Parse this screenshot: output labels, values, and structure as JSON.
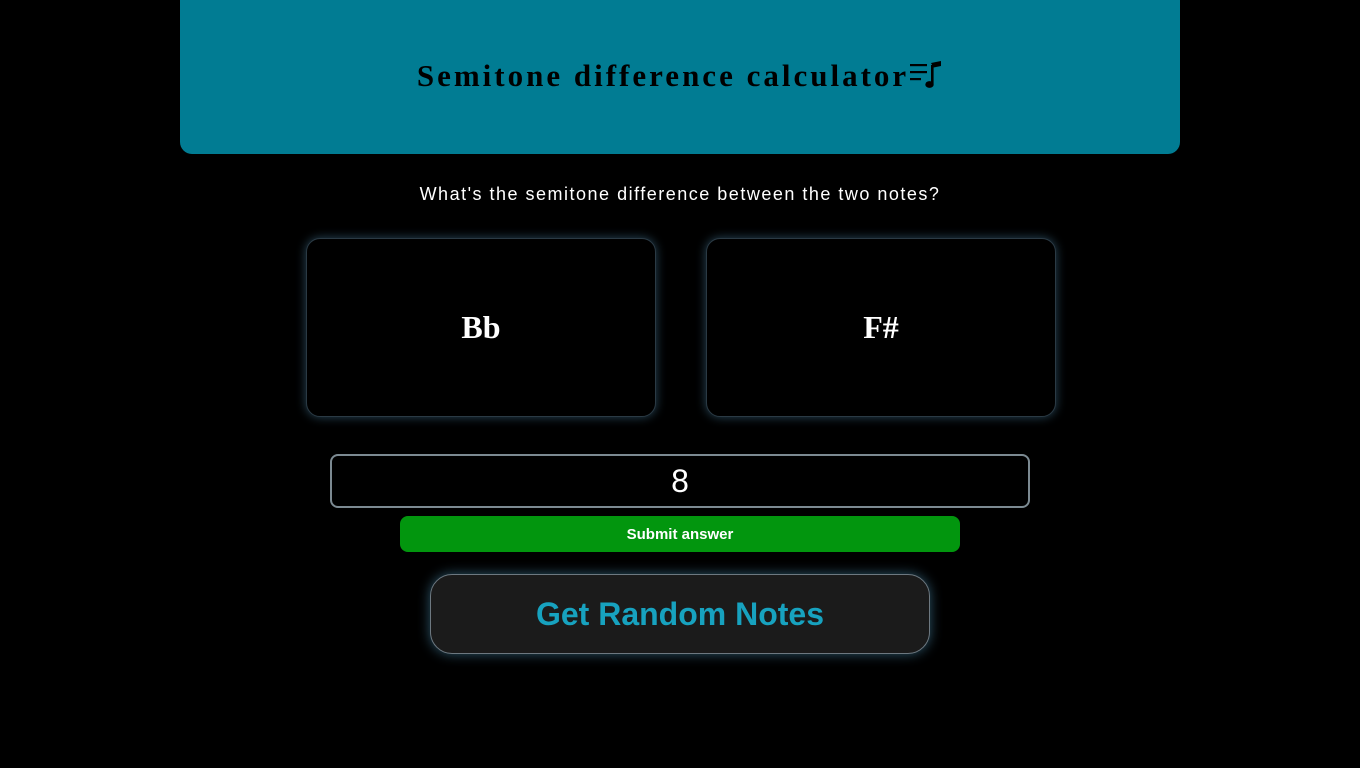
{
  "header": {
    "title": "Semitone difference calculator",
    "icon": "music-playlist-icon"
  },
  "question": "What's the semitone difference between the two notes?",
  "notes": [
    {
      "label": "Bb"
    },
    {
      "label": "F#"
    }
  ],
  "answer": {
    "value": "8",
    "placeholder": ""
  },
  "buttons": {
    "submit_label": "Submit answer",
    "random_label": "Get Random Notes"
  },
  "colors": {
    "header_bg": "#017c93",
    "page_bg": "#000000",
    "submit_bg": "#02960e",
    "random_text": "#17a2bf"
  }
}
